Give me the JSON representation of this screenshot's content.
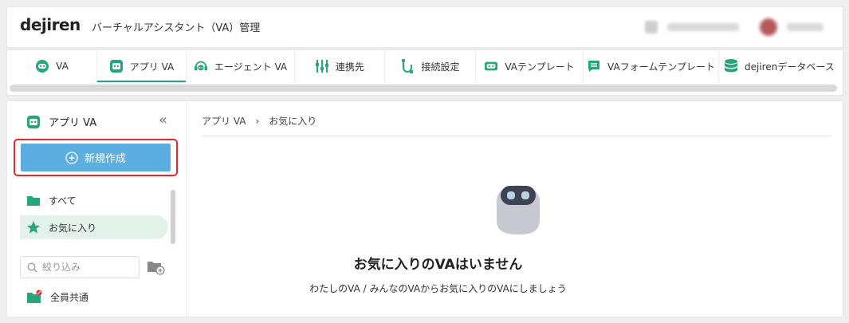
{
  "header": {
    "logo": "dejiren",
    "title": "バーチャルアシスタント（VA）管理"
  },
  "tabs": [
    {
      "label": "VA",
      "icon": "robot-head-icon"
    },
    {
      "label": "アプリ VA",
      "icon": "app-robot-icon",
      "active": true
    },
    {
      "label": "エージェント VA",
      "icon": "headset-icon"
    },
    {
      "label": "連携先",
      "icon": "sliders-icon"
    },
    {
      "label": "接続設定",
      "icon": "plug-icon"
    },
    {
      "label": "VAテンプレート",
      "icon": "template-robot-icon"
    },
    {
      "label": "VAフォームテンプレート",
      "icon": "form-template-icon"
    },
    {
      "label": "dejirenデータベース",
      "icon": "database-icon"
    }
  ],
  "sidebar": {
    "title": "アプリ VA",
    "new_button_label": "新規作成",
    "items": [
      {
        "label": "すべて",
        "icon": "folder-icon"
      },
      {
        "label": "お気に入り",
        "icon": "star-icon",
        "selected": true
      }
    ],
    "filter_placeholder": "絞り込み",
    "shared_folder_label": "全員共通"
  },
  "breadcrumb": {
    "parent": "アプリ VA",
    "separator": "›",
    "current": "お気に入り"
  },
  "empty_state": {
    "title": "お気に入りのVAはいません",
    "subtitle": "わたしのVA / みんなのVAからお気に入りのVAにしましょう"
  },
  "colors": {
    "accent_green": "#27a57d",
    "primary_button": "#5caee0",
    "highlight_outline": "#e8272f",
    "selected_item_bg": "#e3f2ea"
  }
}
